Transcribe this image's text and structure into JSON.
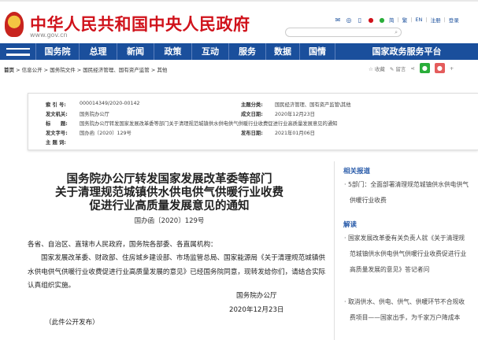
{
  "header": {
    "title": "中华人民共和国中央人民政府",
    "url": "www.gov.cn",
    "links": [
      "简",
      "繁",
      "EN",
      "注册",
      "登录"
    ],
    "icons": [
      "mail-icon",
      "app-icon",
      "mobile-icon",
      "weibo-icon",
      "wechat-icon"
    ],
    "search_icon": "⌕"
  },
  "nav": [
    "国务院",
    "总理",
    "新闻",
    "政策",
    "互动",
    "服务",
    "数据",
    "国情",
    "国家政务服务平台"
  ],
  "breadcrumb": [
    "首页",
    "信息公开",
    "国务院文件",
    "国民经济管理、国有资产监管",
    "其他"
  ],
  "share": {
    "favorite": "☆ 收藏",
    "comment": "✎ 留言"
  },
  "info": {
    "index_label": "索 引 号:",
    "index": "000014349/2020-00142",
    "topic_label": "主题分类:",
    "topic": "国民经济管理、国有资产监管\\其他",
    "issuer_label": "发文机关:",
    "issuer": "国务院办公厅",
    "date_label": "成文日期:",
    "date": "2020年12月23日",
    "title_label": "标　　题:",
    "title": "国务院办公厅转发国家发展改革委等部门关于清理规范城镇供水供电供气供暖行业收费促进行业高质量发展意见的通知",
    "docno_label": "发文字号:",
    "docno": "国办函〔2020〕129号",
    "pub_label": "发布日期:",
    "pub": "2021年01月06日",
    "keywords_label": "主 题 词:"
  },
  "doc": {
    "title": [
      "国务院办公厅转发国家发展改革委等部门",
      "关于清理规范城镇供水供电供气供暖行业收费",
      "促进行业高质量发展意见的通知"
    ],
    "number": "国办函〔2020〕129号",
    "salutation": "各省、自治区、直辖市人民政府，国务院各部委、各直属机构：",
    "body": "国家发展改革委、财政部、住房城乡建设部、市场监管总局、国家能源局《关于清理规范城镇供水供电供气供暖行业收费促进行业高质量发展的意见》已经国务院同意，现转发给你们，请结合实际认真组织实施。",
    "signer": "国务院办公厅",
    "sign_date": "2020年12月23日",
    "note": "（此件公开发布）"
  },
  "sidebar": {
    "related_title": "相关报道",
    "related": [
      "5部门：全面部署清理规范城镇供水供电供气供暖行业收费"
    ],
    "interpret_title": "解读",
    "interpret": [
      "国家发展改革委有关负责人就《关于清理规范城镇供水供电供气供暖行业收费促进行业高质量发展的意见》答记者问",
      "取消供水、供电、供气、供暖环节不合规收费项目——国家出手，为千家万户降成本"
    ]
  },
  "colors": {
    "brand_red": "#d0121b",
    "nav_blue": "#1a4f9c",
    "link_blue": "#2a5caa"
  }
}
